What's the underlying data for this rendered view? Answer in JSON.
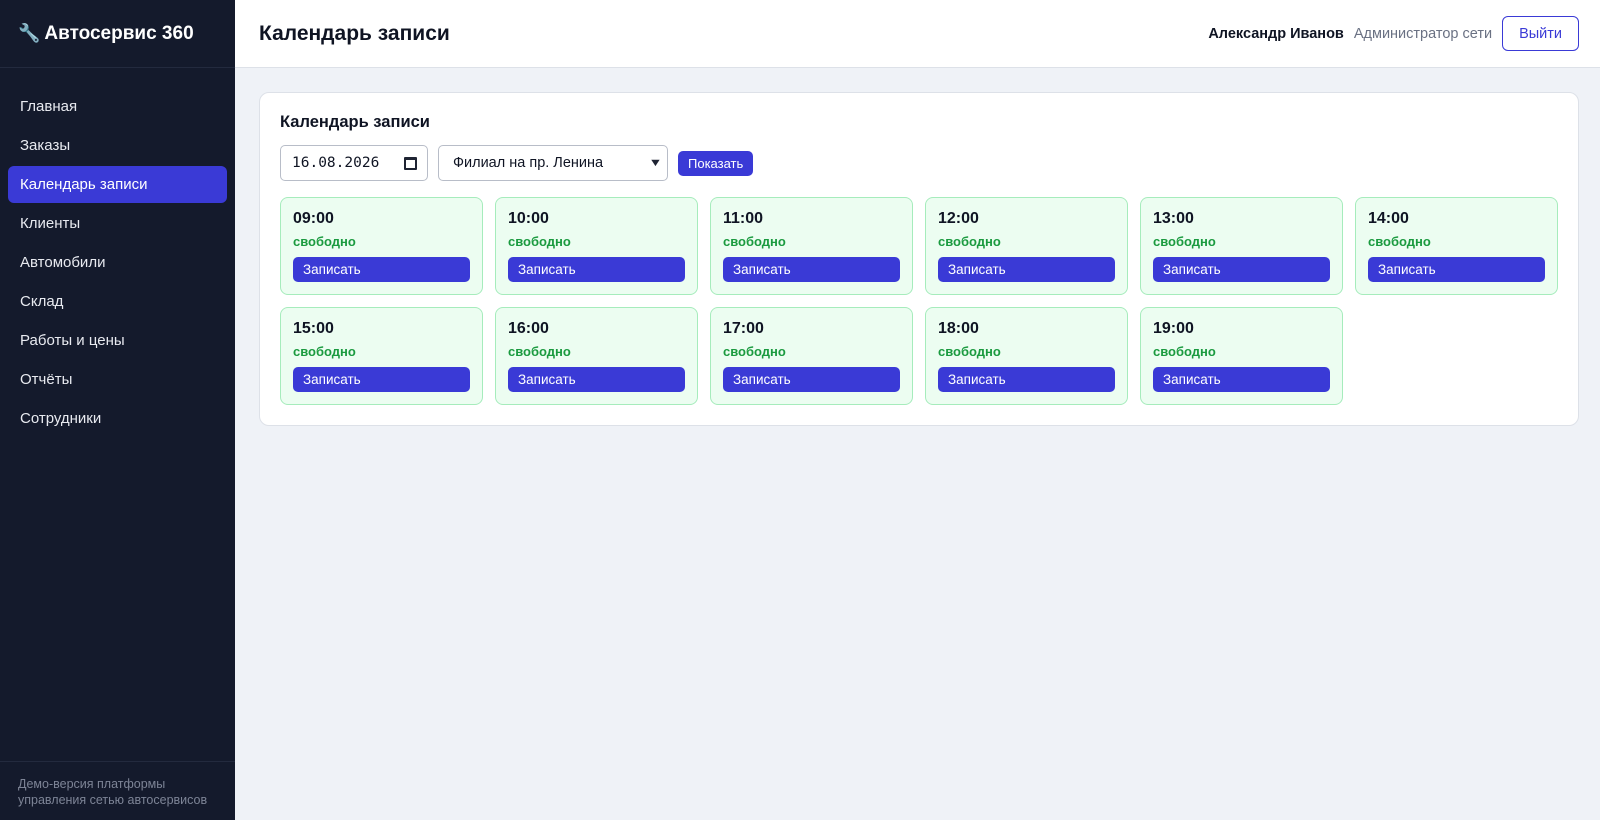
{
  "sidebar": {
    "brand_icon": "wrench-icon",
    "brand": "Автосервис 360",
    "items": [
      {
        "label": "Главная",
        "active": false
      },
      {
        "label": "Заказы",
        "active": false
      },
      {
        "label": "Календарь записи",
        "active": true
      },
      {
        "label": "Клиенты",
        "active": false
      },
      {
        "label": "Автомобили",
        "active": false
      },
      {
        "label": "Склад",
        "active": false
      },
      {
        "label": "Работы и цены",
        "active": false
      },
      {
        "label": "Отчёты",
        "active": false
      },
      {
        "label": "Сотрудники",
        "active": false
      }
    ],
    "footer": "Демо-версия платформы управления сетью автосервисов"
  },
  "header": {
    "title": "Календарь записи",
    "user_name": "Александр Иванов",
    "user_role": "Администратор сети",
    "logout_label": "Выйти"
  },
  "calendar": {
    "title": "Календарь записи",
    "date_value": "16.08.2026",
    "branch_selected": "Филиал на пр. Ленина",
    "show_label": "Показать",
    "slots": [
      {
        "time": "09:00",
        "status": "свободно",
        "action": "Записать"
      },
      {
        "time": "10:00",
        "status": "свободно",
        "action": "Записать"
      },
      {
        "time": "11:00",
        "status": "свободно",
        "action": "Записать"
      },
      {
        "time": "12:00",
        "status": "свободно",
        "action": "Записать"
      },
      {
        "time": "13:00",
        "status": "свободно",
        "action": "Записать"
      },
      {
        "time": "14:00",
        "status": "свободно",
        "action": "Записать"
      },
      {
        "time": "15:00",
        "status": "свободно",
        "action": "Записать"
      },
      {
        "time": "16:00",
        "status": "свободно",
        "action": "Записать"
      },
      {
        "time": "17:00",
        "status": "свободно",
        "action": "Записать"
      },
      {
        "time": "18:00",
        "status": "свободно",
        "action": "Записать"
      },
      {
        "time": "19:00",
        "status": "свободно",
        "action": "Записать"
      }
    ]
  },
  "colors": {
    "sidebar_bg": "#141a2c",
    "accent": "#3a3ad6",
    "slot_free_bg": "#ecfdf1",
    "slot_free_text": "#1a9a3f"
  }
}
